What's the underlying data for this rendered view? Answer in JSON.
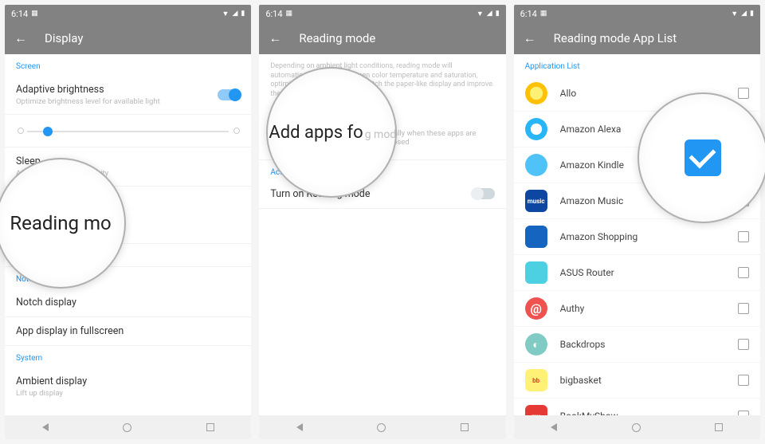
{
  "status": {
    "time": "6:14"
  },
  "screen1": {
    "title": "Display",
    "sections": {
      "screen": "Screen",
      "notch": "Notch",
      "system": "System"
    },
    "rows": {
      "adaptive": {
        "title": "Adaptive brightness",
        "sub": "Optimize brightness level for available light"
      },
      "sleep": {
        "title": "Sleep",
        "sub": "After 2 minutes of inactivity"
      },
      "notch_display": {
        "title": "Notch display"
      },
      "fullscreen": {
        "title": "App display in fullscreen"
      },
      "ambient": {
        "title": "Ambient display",
        "sub": "Lift up display"
      }
    },
    "magnifier": "Reading mo"
  },
  "screen2": {
    "title": "Reading mode",
    "desc": "Depending on ambient light conditions, reading mode will automatically adjust the screen color temperature and saturation, optimized for text reading to match the paper-like display and improve the reading experience.",
    "add_apps": {
      "title": "Add apps for Reading mode",
      "sub": "Reading mode will turn on automatically when these apps are opened and turn off when they are closed"
    },
    "activate": "Activate manually",
    "turn_on": "Turn on Reading mode",
    "magnifier": "Add apps fo",
    "magnifier_faint": "g mode"
  },
  "screen3": {
    "title": "Reading mode App List",
    "section": "Application List",
    "apps": [
      {
        "name": "Allo",
        "icon_bg": "#ffc107",
        "checked": false
      },
      {
        "name": "Amazon Alexa",
        "icon_bg": "#29b6f6",
        "checked": false
      },
      {
        "name": "Amazon Kindle",
        "icon_bg": "#4fc3f7",
        "checked": true
      },
      {
        "name": "Amazon Music",
        "icon_bg": "#0d47a1",
        "icon_text": "music",
        "checked": false
      },
      {
        "name": "Amazon Shopping",
        "icon_bg": "#1565c0",
        "checked": false
      },
      {
        "name": "ASUS Router",
        "icon_bg": "#4dd0e1",
        "checked": false
      },
      {
        "name": "Authy",
        "icon_bg": "#ef5350",
        "checked": false
      },
      {
        "name": "Backdrops",
        "icon_bg": "#80cbc4",
        "checked": false
      },
      {
        "name": "bigbasket",
        "icon_bg": "#fff176",
        "icon_text": "bb",
        "icon_fg": "#e53935",
        "checked": false
      },
      {
        "name": "BookMyShow",
        "icon_bg": "#e53935",
        "icon_text": "my",
        "checked": false
      }
    ]
  }
}
